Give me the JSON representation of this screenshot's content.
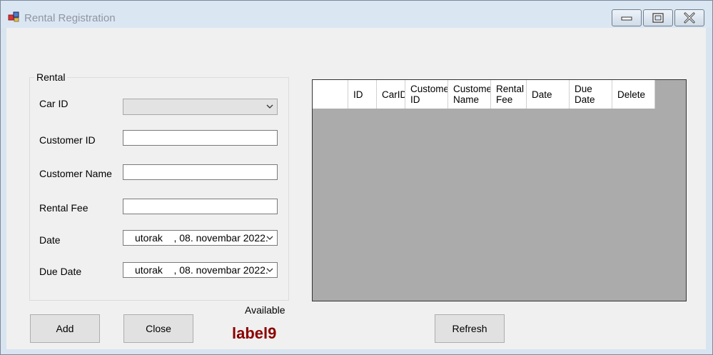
{
  "window": {
    "title": "Rental Registration",
    "controls": {
      "minimize": "minimize-icon",
      "maximize": "maximize-icon",
      "close": "close-icon"
    }
  },
  "rental_group": {
    "title": "Rental",
    "fields": {
      "car_id": {
        "label": "Car ID",
        "value": ""
      },
      "customer_id": {
        "label": "Customer ID",
        "value": ""
      },
      "customer_name": {
        "label": "Customer Name",
        "value": ""
      },
      "rental_fee": {
        "label": "Rental Fee",
        "value": ""
      },
      "date": {
        "label": "Date",
        "value": "utorak    , 08. novembar 2022."
      },
      "due_date": {
        "label": "Due Date",
        "value": "utorak    , 08. novembar 2022."
      }
    }
  },
  "buttons": {
    "add": "Add",
    "close": "Close",
    "refresh": "Refresh"
  },
  "status": {
    "available_label": "Available",
    "value_label": "label9",
    "value_color": "#8b0000"
  },
  "grid": {
    "columns": [
      {
        "label": ""
      },
      {
        "label": "ID"
      },
      {
        "label": "CarID"
      },
      {
        "label": "Customer\nID"
      },
      {
        "label": "Customer\nName"
      },
      {
        "label": "Rental\nFee"
      },
      {
        "label": "Date"
      },
      {
        "label": "Due\nDate"
      },
      {
        "label": "Delete"
      }
    ],
    "rows": []
  },
  "colors": {
    "grid_background": "#ababab",
    "form_background": "#f0f0f0",
    "title_text": "#8f96a0"
  }
}
